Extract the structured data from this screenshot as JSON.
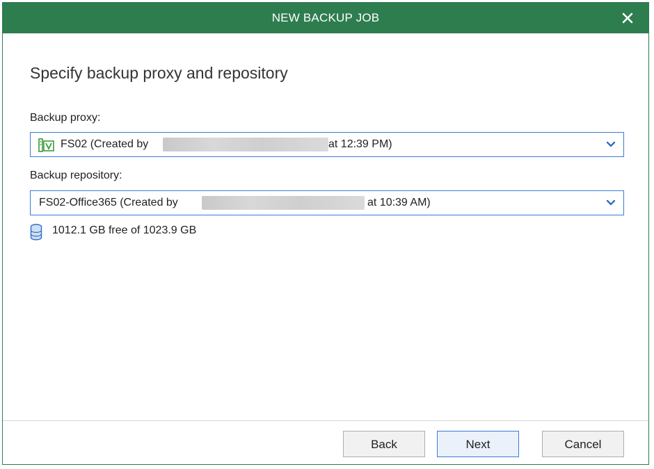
{
  "dialog": {
    "title": "NEW BACKUP JOB",
    "heading": "Specify backup proxy and repository"
  },
  "proxy": {
    "label": "Backup proxy:",
    "icon": "server-proxy-icon",
    "value_prefix": "FS02 (Created by",
    "value_suffix": "at 12:39 PM)"
  },
  "repository": {
    "label": "Backup repository:",
    "value_prefix": "FS02-Office365 (Created by",
    "value_suffix": "at 10:39 AM)",
    "storage_icon": "database-icon",
    "storage_info": "1012.1 GB free of 1023.9 GB"
  },
  "buttons": {
    "back": "Back",
    "next": "Next",
    "cancel": "Cancel"
  },
  "colors": {
    "title_bar": "#2e7d4f",
    "focus_border": "#3a7ad8",
    "icon_blue": "#2f6fc4",
    "proxy_icon_green": "#3a9a3a"
  }
}
